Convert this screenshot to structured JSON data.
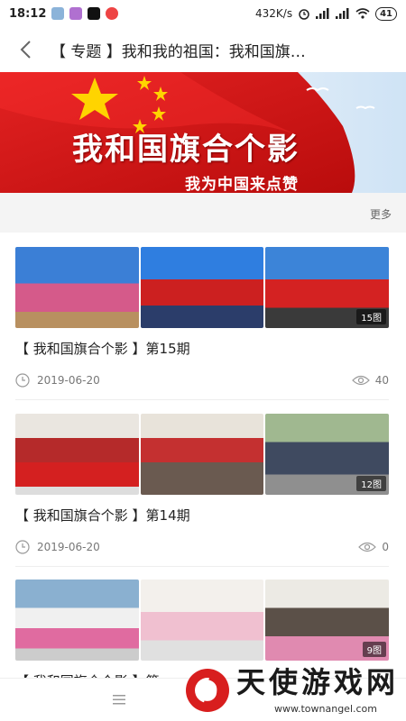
{
  "status": {
    "time": "18:12",
    "net_speed": "432K/s",
    "battery": "41"
  },
  "header": {
    "title": "【 专题 】我和我的祖国：我和国旗…"
  },
  "banner": {
    "title": "我和国旗合个影",
    "subtitle": "我为中国来点赞"
  },
  "more_label": "更多",
  "articles": [
    {
      "title": "【 我和国旗合个影 】第15期",
      "date": "2019-06-20",
      "views": "40",
      "photo_count": "15图"
    },
    {
      "title": "【 我和国旗合个影 】第14期",
      "date": "2019-06-20",
      "views": "0",
      "photo_count": "12图"
    },
    {
      "title": "【 我和国旗合个影 】第",
      "photo_count": "9图"
    }
  ],
  "watermark": {
    "brand": "天使游戏网",
    "url": "www.townangel.com"
  },
  "colors": {
    "flag_red": "#d81e1e",
    "star_yellow": "#ffd400"
  }
}
